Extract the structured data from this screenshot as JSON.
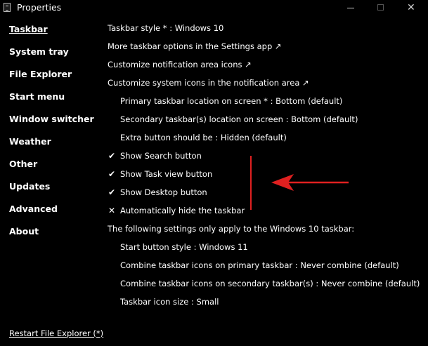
{
  "window": {
    "title": "Properties",
    "minimize_glyph": "",
    "close_glyph": "✕"
  },
  "sidebar": {
    "items": [
      {
        "label": "Taskbar",
        "active": true
      },
      {
        "label": "System tray"
      },
      {
        "label": "File Explorer"
      },
      {
        "label": "Start menu"
      },
      {
        "label": "Window switcher"
      },
      {
        "label": "Weather"
      },
      {
        "label": "Other"
      },
      {
        "label": "Updates"
      },
      {
        "label": "Advanced"
      },
      {
        "label": "About"
      }
    ],
    "restart_link": "Restart File Explorer (*)"
  },
  "options": {
    "taskbar_style": {
      "label": "Taskbar style * ",
      "value": " Windows 10"
    },
    "more_taskbar_options": "More taskbar options in the Settings app ↗",
    "customize_notification_icons": "Customize notification area icons ↗",
    "customize_system_icons": "Customize system icons in the notification area ↗",
    "primary_location": {
      "label": "Primary taskbar location on screen * ",
      "value": " Bottom (default)"
    },
    "secondary_location": {
      "label": "Secondary taskbar(s) location on screen ",
      "value": " Bottom (default)"
    },
    "extra_button": {
      "label": "Extra button should be ",
      "value": " Hidden (default)"
    },
    "show_search": {
      "label": "Show Search button",
      "state": "checked",
      "glyph": "✔"
    },
    "show_task_view": {
      "label": "Show Task view button",
      "state": "checked",
      "glyph": "✔"
    },
    "show_desktop": {
      "label": "Show Desktop button",
      "state": "checked",
      "glyph": "✔"
    },
    "auto_hide": {
      "label": "Automatically hide the taskbar",
      "state": "unchecked",
      "glyph": "✕"
    },
    "win10_note": "The following settings only apply to the Windows 10 taskbar:",
    "start_button_style": {
      "label": "Start button style ",
      "value": " Windows 11"
    },
    "combine_primary": {
      "label": "Combine taskbar icons on primary taskbar ",
      "value": " Never combine (default)"
    },
    "combine_secondary": {
      "label": "Combine taskbar icons on secondary taskbar(s) ",
      "value": " Never combine (default)"
    },
    "icon_size": {
      "label": "Taskbar icon size ",
      "value": " Small"
    }
  },
  "annotation": {
    "color": "#e02020"
  },
  "colors": {
    "background": "#000000",
    "text": "#ffffff"
  }
}
